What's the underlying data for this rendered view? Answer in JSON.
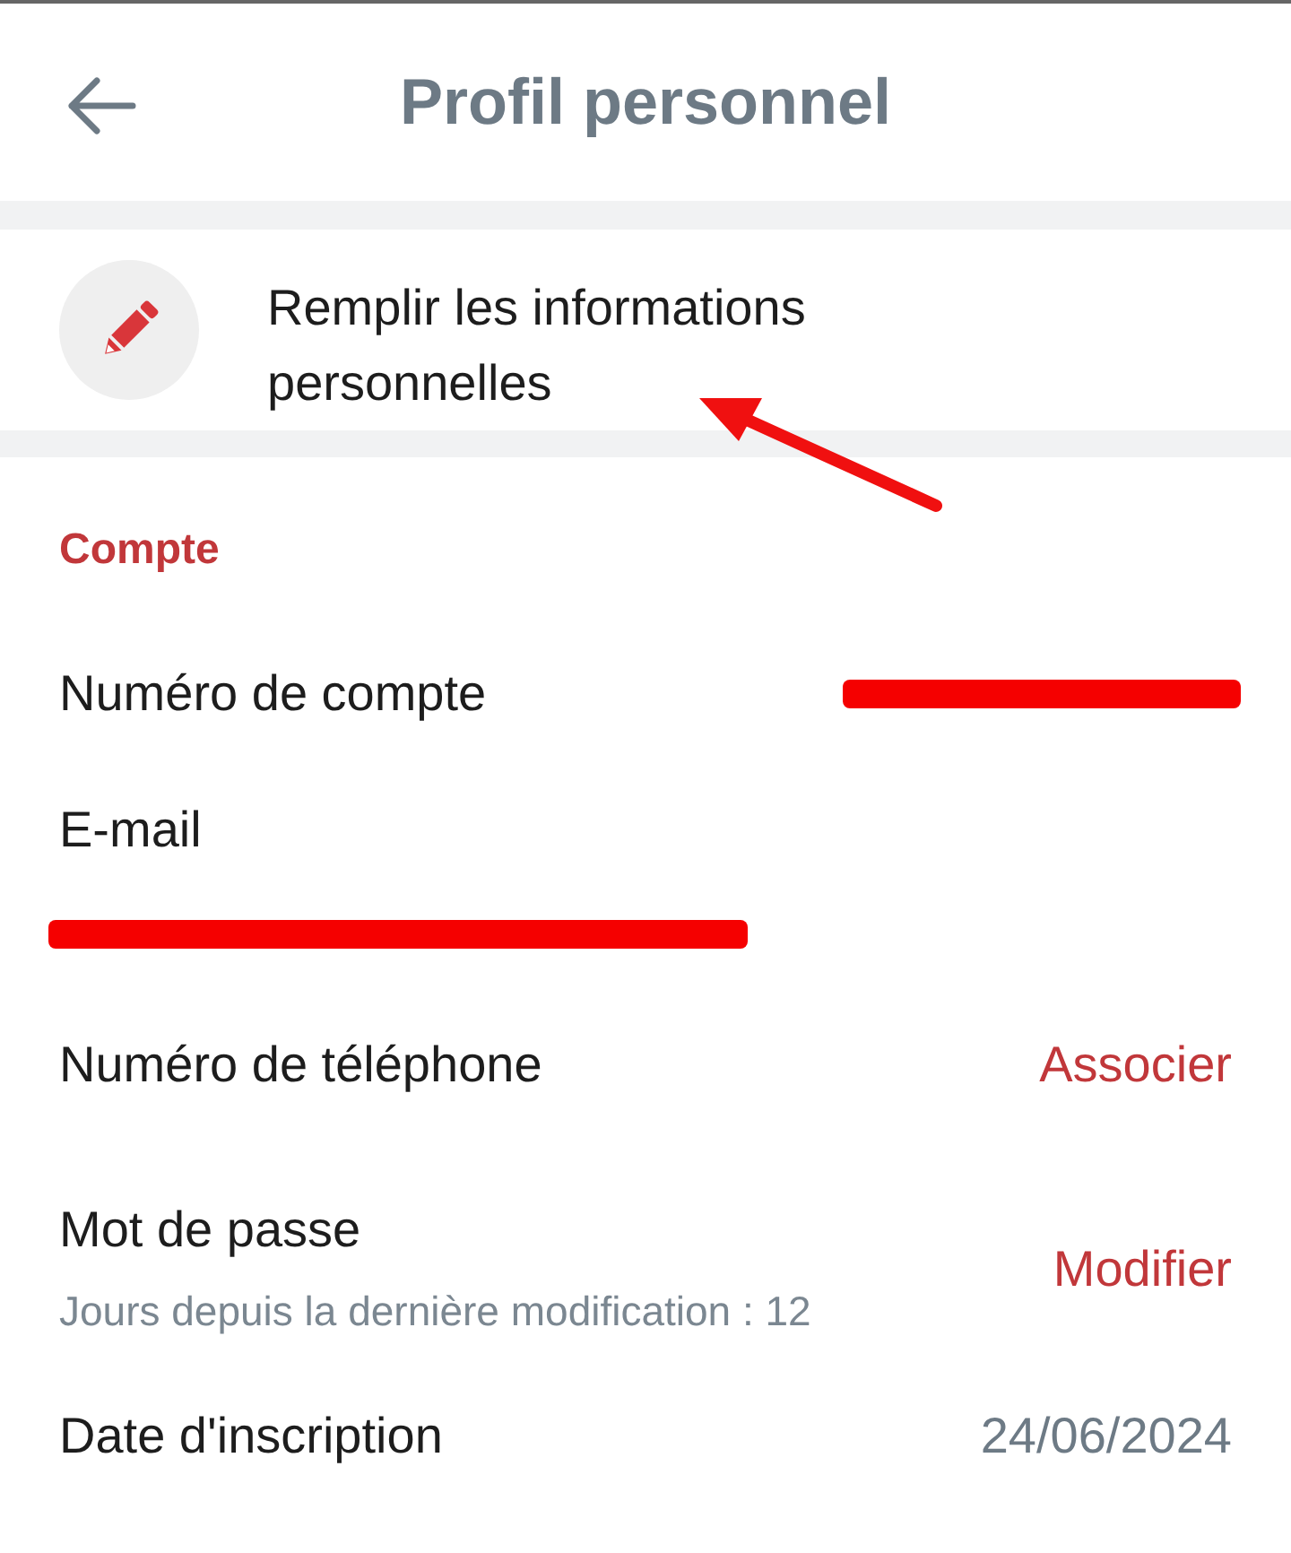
{
  "header": {
    "title": "Profil personnel"
  },
  "banner": {
    "text": "Remplir les informations personnelles"
  },
  "section": {
    "title": "Compte"
  },
  "rows": [
    {
      "label": "Numéro de compte",
      "kind": "redacted"
    },
    {
      "label": "E-mail",
      "kind": "redacted_below"
    },
    {
      "label": "Numéro de téléphone",
      "kind": "action",
      "action": "Associer"
    },
    {
      "label": "Mot de passe",
      "kind": "action",
      "action": "Modifier",
      "note": "Jours depuis la dernière modification :  12"
    },
    {
      "label": "Date d'inscription",
      "kind": "value",
      "value": "24/06/2024"
    }
  ]
}
